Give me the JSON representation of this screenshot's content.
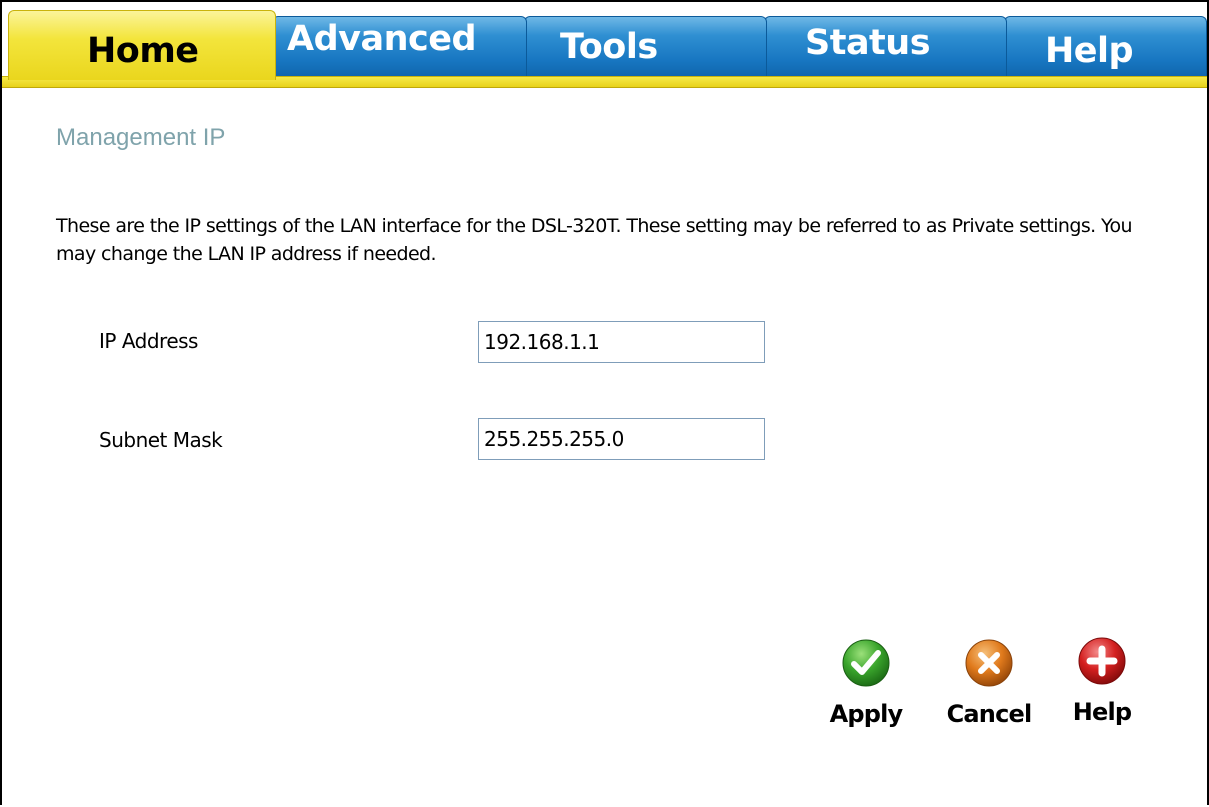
{
  "nav": {
    "tabs": [
      {
        "label": "Home",
        "active": true
      },
      {
        "label": "Advanced",
        "active": false
      },
      {
        "label": "Tools",
        "active": false
      },
      {
        "label": "Status",
        "active": false
      },
      {
        "label": "Help",
        "active": false
      }
    ]
  },
  "page": {
    "title": "Management IP",
    "description": "These are the IP settings of the LAN interface for the DSL-320T. These setting may be referred to as Private settings. You may change the LAN IP address if needed."
  },
  "form": {
    "ip_address": {
      "label": "IP Address",
      "value": "192.168.1.1"
    },
    "subnet_mask": {
      "label": "Subnet Mask",
      "value": "255.255.255.0"
    }
  },
  "actions": {
    "apply": {
      "label": "Apply",
      "icon": "check-icon",
      "color": "#3aa52c"
    },
    "cancel": {
      "label": "Cancel",
      "icon": "x-icon",
      "color": "#e07a1c"
    },
    "help": {
      "label": "Help",
      "icon": "plus-icon",
      "color": "#d42020"
    }
  },
  "colors": {
    "tab_active": "#f3e53c",
    "tab_inactive": "#1f7fc6",
    "title": "#7fa3ab"
  }
}
